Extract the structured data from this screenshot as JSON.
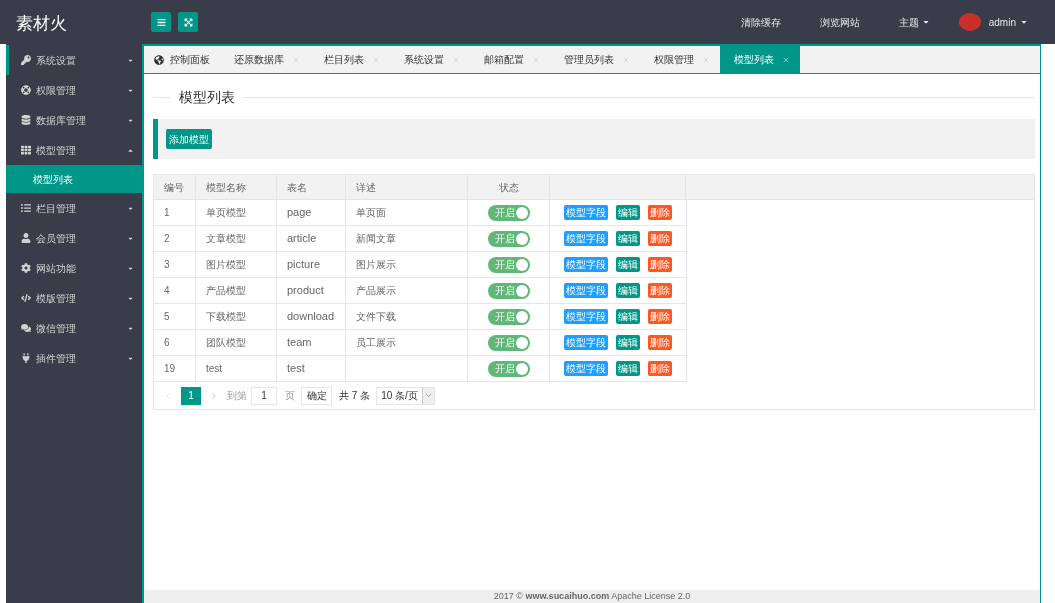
{
  "header": {
    "brand": "素材火",
    "links": [
      {
        "label": "清除缓存"
      },
      {
        "label": "浏览网站"
      }
    ],
    "theme_menu": {
      "label": "主题"
    },
    "user": {
      "name": "admin"
    }
  },
  "sidebar": {
    "items": [
      {
        "label": "系统设置",
        "selected": true,
        "expanded": false
      },
      {
        "label": "权限管理",
        "selected": false,
        "expanded": false
      },
      {
        "label": "数据库管理",
        "selected": false,
        "expanded": false
      },
      {
        "label": "模型管理",
        "selected": false,
        "expanded": true,
        "children": [
          {
            "label": "模型列表",
            "selected": true
          }
        ]
      },
      {
        "label": "栏目管理",
        "selected": false,
        "expanded": false
      },
      {
        "label": "会员管理",
        "selected": false,
        "expanded": false
      },
      {
        "label": "网站功能",
        "selected": false,
        "expanded": false
      },
      {
        "label": "模版管理",
        "selected": false,
        "expanded": false
      },
      {
        "label": "微信管理",
        "selected": false,
        "expanded": false
      },
      {
        "label": "插件管理",
        "selected": false,
        "expanded": false
      }
    ]
  },
  "tabs": [
    {
      "label": "控制面板",
      "kind": "home",
      "selected": false
    },
    {
      "label": "还原数据库",
      "kind": "page",
      "selected": false
    },
    {
      "label": "栏目列表",
      "kind": "page",
      "selected": false
    },
    {
      "label": "系统设置",
      "kind": "page",
      "selected": false
    },
    {
      "label": "邮箱配置",
      "kind": "page",
      "selected": false
    },
    {
      "label": "管理员列表",
      "kind": "page",
      "selected": false
    },
    {
      "label": "权限管理",
      "kind": "page",
      "selected": false
    },
    {
      "label": "模型列表",
      "kind": "page",
      "selected": true
    }
  ],
  "page": {
    "legend": "模型列表",
    "add_button": "添加模型"
  },
  "table": {
    "columns": [
      "编号",
      "模型名称",
      "表名",
      "详述",
      "状态"
    ],
    "rows": [
      {
        "id": "1",
        "name": "单页模型",
        "table_name": "page",
        "description": "单页面",
        "status": {
          "label": "开启",
          "on": true
        },
        "actions": [
          {
            "label": "模型字段",
            "kind": "normal"
          },
          {
            "label": "编辑",
            "kind": "default"
          },
          {
            "label": "删除",
            "kind": "danger"
          }
        ]
      },
      {
        "id": "2",
        "name": "文章模型",
        "table_name": "article",
        "description": "新闻文章",
        "status": {
          "label": "开启",
          "on": true
        },
        "actions": [
          {
            "label": "模型字段",
            "kind": "normal"
          },
          {
            "label": "编辑",
            "kind": "default"
          },
          {
            "label": "删除",
            "kind": "danger"
          }
        ]
      },
      {
        "id": "3",
        "name": "图片模型",
        "table_name": "picture",
        "description": "图片展示",
        "status": {
          "label": "开启",
          "on": true
        },
        "actions": [
          {
            "label": "模型字段",
            "kind": "normal"
          },
          {
            "label": "编辑",
            "kind": "default"
          },
          {
            "label": "删除",
            "kind": "danger"
          }
        ]
      },
      {
        "id": "4",
        "name": "产品模型",
        "table_name": "product",
        "description": "产品展示",
        "status": {
          "label": "开启",
          "on": true
        },
        "actions": [
          {
            "label": "模型字段",
            "kind": "normal"
          },
          {
            "label": "编辑",
            "kind": "default"
          },
          {
            "label": "删除",
            "kind": "danger"
          }
        ]
      },
      {
        "id": "5",
        "name": "下载模型",
        "table_name": "download",
        "description": "文件下载",
        "status": {
          "label": "开启",
          "on": true
        },
        "actions": [
          {
            "label": "模型字段",
            "kind": "normal"
          },
          {
            "label": "编辑",
            "kind": "default"
          },
          {
            "label": "删除",
            "kind": "danger"
          }
        ]
      },
      {
        "id": "6",
        "name": "团队模型",
        "table_name": "team",
        "description": "员工展示",
        "status": {
          "label": "开启",
          "on": true
        },
        "actions": [
          {
            "label": "模型字段",
            "kind": "normal"
          },
          {
            "label": "编辑",
            "kind": "default"
          },
          {
            "label": "删除",
            "kind": "danger"
          }
        ]
      },
      {
        "id": "19",
        "name": "test",
        "table_name": "test",
        "status": {
          "label": "开启",
          "on": true
        },
        "actions": [
          {
            "label": "模型字段",
            "kind": "normal"
          },
          {
            "label": "编辑",
            "kind": "default"
          },
          {
            "label": "删除",
            "kind": "danger"
          }
        ]
      }
    ]
  },
  "pagination": {
    "pages": [
      {
        "label": "1",
        "selected": true
      }
    ],
    "goto_label": "到第",
    "page_input": "1",
    "page_unit": "页",
    "confirm_button": "确定",
    "total": "共 7 条",
    "page_size": "10 条/页"
  },
  "footer": {
    "text": "2017 © **www.sucaihuo.com** Apache License 2.0"
  }
}
